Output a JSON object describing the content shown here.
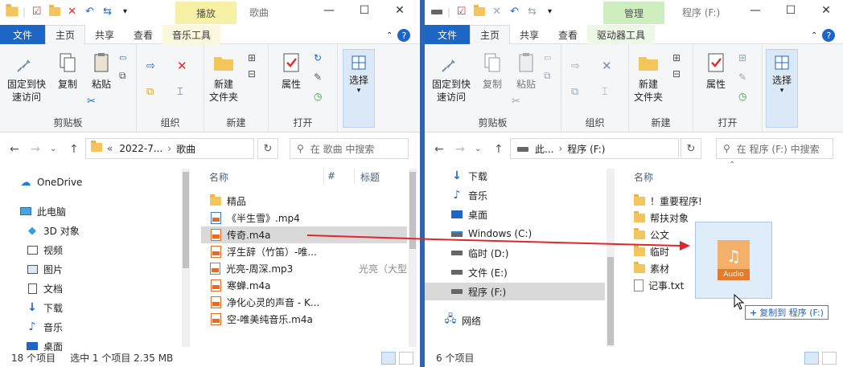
{
  "left": {
    "title": "歌曲",
    "context_tab": "播放",
    "context_subtab": "音乐工具",
    "ribbon_tabs": [
      "文件",
      "主页",
      "共享",
      "查看"
    ],
    "ribbon": {
      "clipboard": {
        "pin": "固定到快速访问",
        "pin_l1": "固定到快",
        "pin_l2": "速访问",
        "copy": "复制",
        "paste": "粘贴",
        "label": "剪贴板"
      },
      "organize": {
        "label": "组织"
      },
      "new": {
        "folder_l1": "新建",
        "folder_l2": "文件夹",
        "label": "新建"
      },
      "open": {
        "props": "属性",
        "label": "打开"
      },
      "select": {
        "label": "选择"
      }
    },
    "address": {
      "chev": "«",
      "crumb1": "2022-7...",
      "crumb2": "歌曲",
      "search_placeholder": "在 歌曲 中搜索"
    },
    "nav": [
      {
        "label": "OneDrive",
        "icon": "cloud-icon"
      },
      {
        "label": "此电脑",
        "icon": "pc-icon"
      },
      {
        "label": "3D 对象",
        "icon": "cube-icon"
      },
      {
        "label": "视频",
        "icon": "video-icon"
      },
      {
        "label": "图片",
        "icon": "pictures-icon"
      },
      {
        "label": "文档",
        "icon": "documents-icon"
      },
      {
        "label": "下载",
        "icon": "download-icon"
      },
      {
        "label": "音乐",
        "icon": "music-icon"
      },
      {
        "label": "桌面",
        "icon": "desktop-icon"
      }
    ],
    "columns": {
      "name": "名称",
      "num": "#",
      "title": "标题"
    },
    "files": [
      {
        "name": "精品",
        "type": "folder"
      },
      {
        "name": "《半生雪》.mp4",
        "type": "video"
      },
      {
        "name": "传奇.m4a",
        "type": "audio",
        "selected": true
      },
      {
        "name": "浮生辞（竹笛）-唯...",
        "type": "audio"
      },
      {
        "name": "光亮-周深.mp3",
        "type": "audio",
        "title": "光亮（大型"
      },
      {
        "name": "寒蝉.m4a",
        "type": "audio"
      },
      {
        "name": "净化心灵的声音 - K...",
        "type": "audio"
      },
      {
        "name": "空-唯美纯音乐.m4a",
        "type": "audio"
      }
    ],
    "status": {
      "count": "18 个项目",
      "selected": "选中 1 个项目  2.35 MB"
    }
  },
  "right": {
    "title": "程序 (F:)",
    "context_tab": "管理",
    "context_subtab": "驱动器工具",
    "ribbon_tabs": [
      "文件",
      "主页",
      "共享",
      "查看"
    ],
    "address": {
      "crumb1": "此...",
      "crumb2": "程序 (F:)",
      "search_placeholder": "在 程序 (F:) 中搜索"
    },
    "nav": [
      {
        "label": "下载",
        "icon": "download-icon"
      },
      {
        "label": "音乐",
        "icon": "music-icon"
      },
      {
        "label": "桌面",
        "icon": "desktop-icon"
      },
      {
        "label": "Windows (C:)",
        "icon": "windows-drive-icon"
      },
      {
        "label": "临时 (D:)",
        "icon": "drive-icon"
      },
      {
        "label": "文件 (E:)",
        "icon": "drive-icon"
      },
      {
        "label": "程序 (F:)",
        "icon": "drive-icon",
        "selected": true
      },
      {
        "label": "网络",
        "icon": "network-icon"
      }
    ],
    "columns": {
      "name": "名称"
    },
    "files": [
      {
        "name": "！重要程序!",
        "type": "folder"
      },
      {
        "name": "帮扶对象",
        "type": "folder"
      },
      {
        "name": "公文",
        "type": "folder"
      },
      {
        "name": "临时",
        "type": "folder"
      },
      {
        "name": "素材",
        "type": "folder"
      },
      {
        "name": "记事.txt",
        "type": "txt"
      }
    ],
    "status": {
      "count": "6 个项目"
    }
  },
  "drag": {
    "file_label": "Audio",
    "tooltip_plus": "+",
    "tooltip_text": "复制到 程序 (F:)"
  },
  "colors": {
    "accent": "#1e66c6",
    "arrow": "#e0262a",
    "selection": "#d9d9d9",
    "play_tab": "#f7f1a6",
    "manage_tab": "#cfeec0"
  }
}
